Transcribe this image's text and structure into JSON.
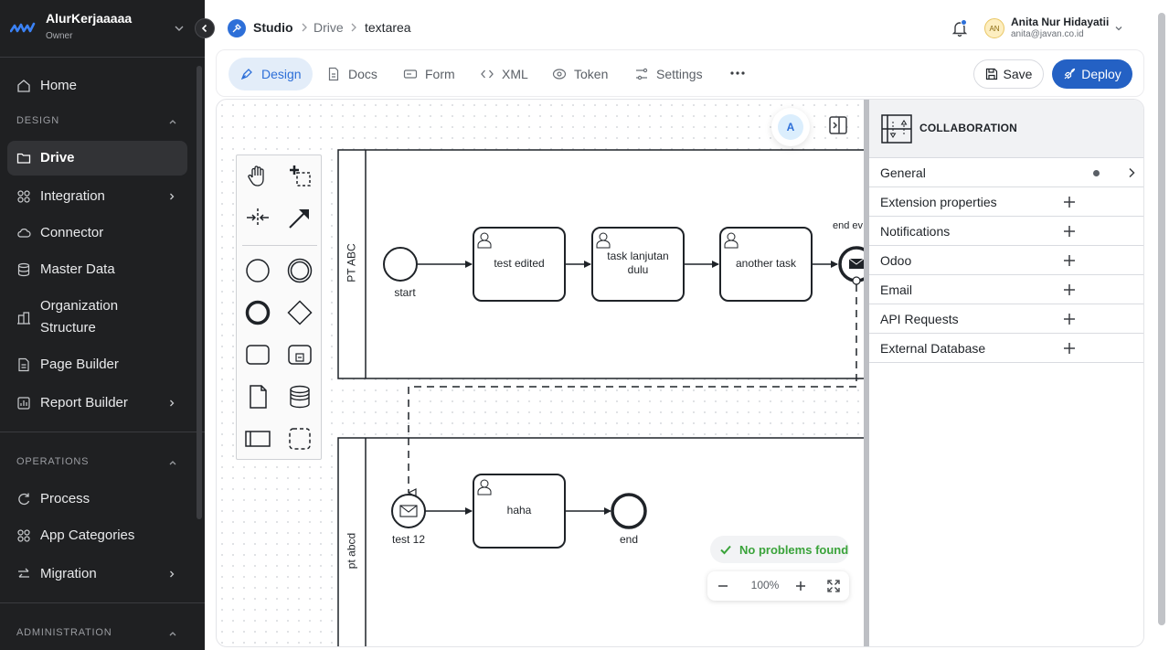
{
  "sidebar": {
    "org_name": "AlurKerjaaaaa",
    "org_role": "Owner",
    "home": "Home",
    "sections": {
      "design": "DESIGN",
      "operations": "OPERATIONS",
      "administration": "ADMINISTRATION"
    },
    "design_items": [
      {
        "label": "Drive"
      },
      {
        "label": "Integration"
      },
      {
        "label": "Connector"
      },
      {
        "label": "Master Data"
      },
      {
        "label": "Organization\nStructure"
      },
      {
        "label": "Page Builder"
      },
      {
        "label": "Report Builder"
      }
    ],
    "operations_items": [
      {
        "label": "Process"
      },
      {
        "label": "App Categories"
      },
      {
        "label": "Migration"
      }
    ]
  },
  "header": {
    "breadcrumbs": [
      "Studio",
      "Drive",
      "textarea"
    ],
    "user": {
      "initials": "AN",
      "name": "Anita Nur Hidayatii",
      "email": "anita@javan.co.id"
    }
  },
  "toolbar": {
    "tabs": [
      {
        "label": "Design",
        "icon": "pen-tool-icon",
        "active": true
      },
      {
        "label": "Docs",
        "icon": "document-icon",
        "active": false
      },
      {
        "label": "Form",
        "icon": "form-icon",
        "active": false
      },
      {
        "label": "XML",
        "icon": "code-icon",
        "active": false
      },
      {
        "label": "Token",
        "icon": "token-icon",
        "active": false
      },
      {
        "label": "Settings",
        "icon": "settings-icon",
        "active": false
      }
    ],
    "save_label": "Save",
    "deploy_label": "Deploy"
  },
  "canvas": {
    "presence_initial": "A",
    "pools": [
      {
        "label": "PT ABC"
      },
      {
        "label": "pt abcd"
      }
    ],
    "nodes": {
      "start": "start",
      "test_edited": "test edited",
      "task_lanjutan": "task lanjutan\ndulu",
      "another_task": "another task",
      "end_event": "end ev",
      "test12": "test 12",
      "haha": "haha",
      "end": "end"
    },
    "problems_label": "No problems found",
    "zoom_level": "100%"
  },
  "properties": {
    "title": "COLLABORATION",
    "groups": [
      {
        "label": "General",
        "expandable": true
      },
      {
        "label": "Extension properties"
      },
      {
        "label": "Notifications"
      },
      {
        "label": "Odoo"
      },
      {
        "label": "Email"
      },
      {
        "label": "API Requests"
      },
      {
        "label": "External Database"
      }
    ]
  },
  "colors": {
    "sidebar_bg": "#1f2022",
    "accent": "#2461c4",
    "success": "#3aa33a"
  }
}
